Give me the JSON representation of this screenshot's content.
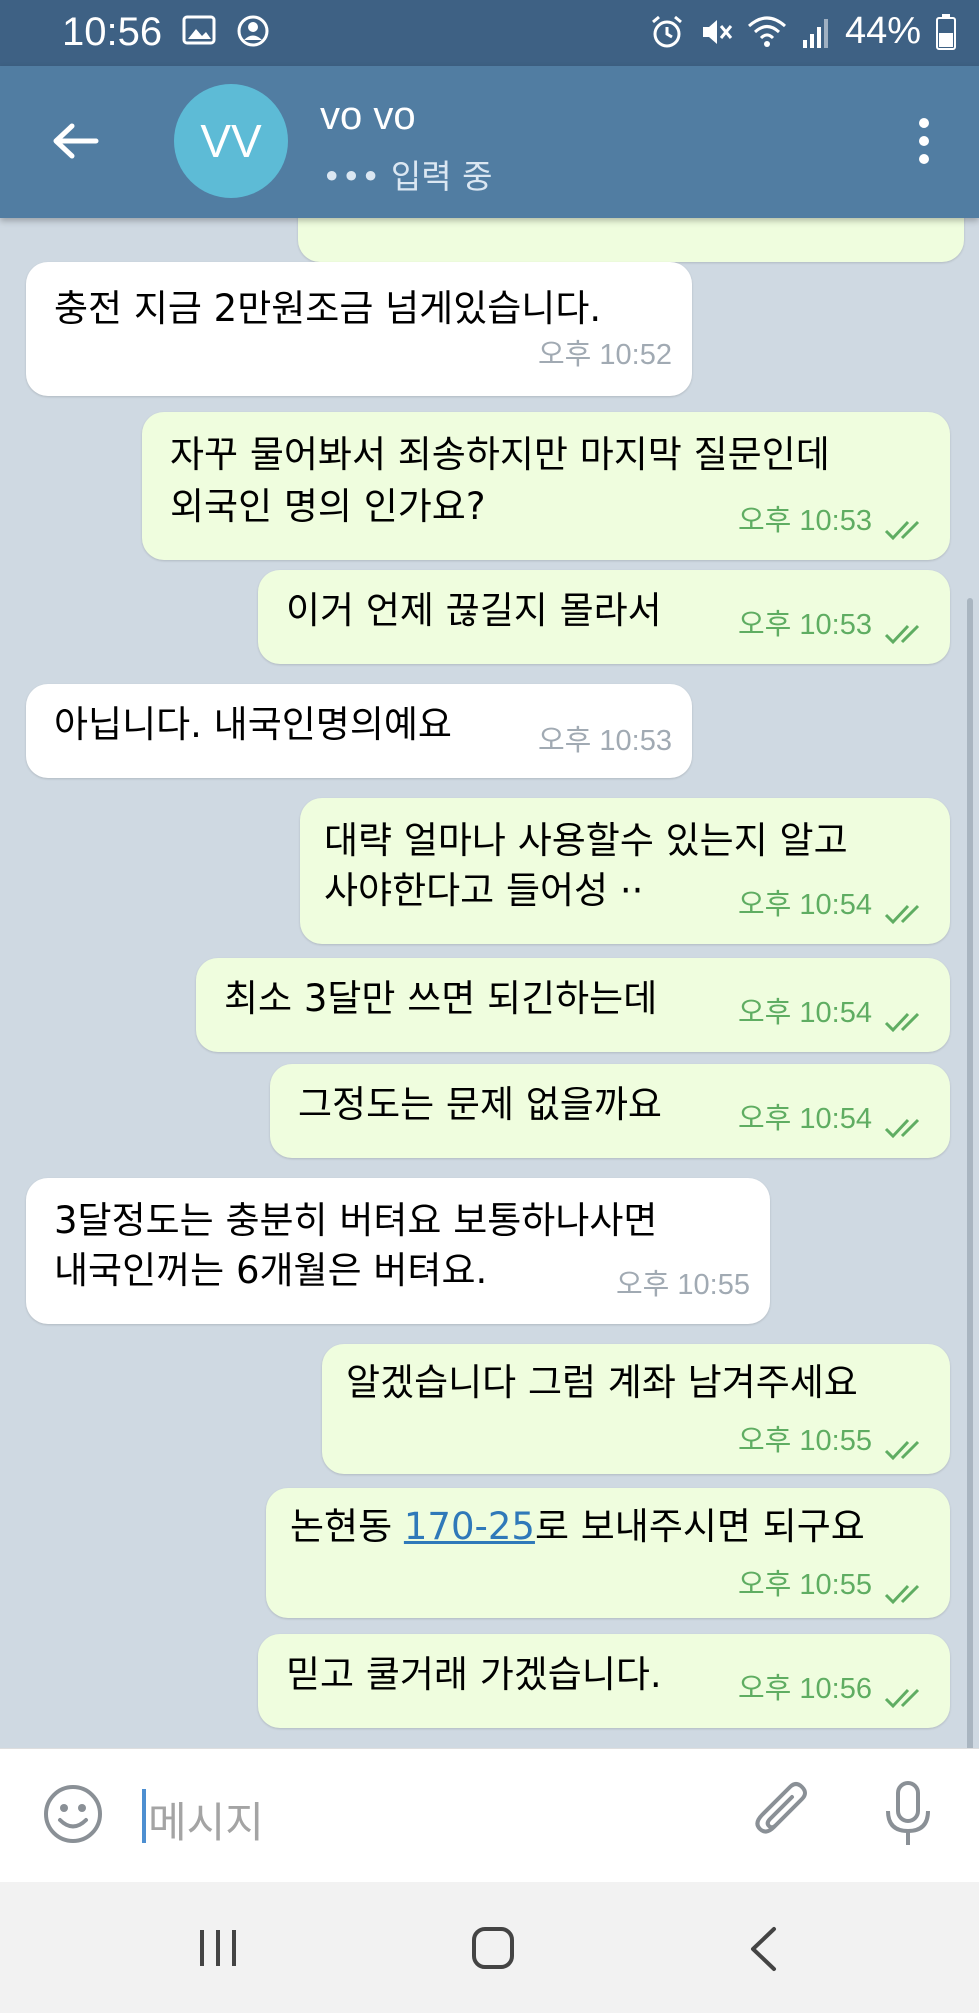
{
  "status_bar": {
    "time": "10:56",
    "battery": "44%"
  },
  "header": {
    "avatar_initials": "VV",
    "name": "vo vo",
    "status": "••• 입력 중"
  },
  "messages": [
    {
      "dir": "in",
      "text": "충전 지금 2만원조금 넘게있습니다.",
      "time": "오후 10:52"
    },
    {
      "dir": "out",
      "lines": [
        "자꾸 물어봐서 죄송하지만 마지막 질문인데",
        "외국인 명의 인가요?"
      ],
      "time": "오후 10:53"
    },
    {
      "dir": "out",
      "text": "이거 언제 끊길지 몰라서",
      "time": "오후 10:53"
    },
    {
      "dir": "in",
      "text": "아닙니다. 내국인명의예요",
      "time": "오후 10:53"
    },
    {
      "dir": "out",
      "lines": [
        "대략 얼마나 사용할수 있는지 알고",
        "사야한다고 들어성 ··"
      ],
      "time": "오후 10:54"
    },
    {
      "dir": "out",
      "text": "최소 3달만 쓰면 되긴하는데",
      "time": "오후 10:54"
    },
    {
      "dir": "out",
      "text": "그정도는 문제 없을까요",
      "time": "오후 10:54"
    },
    {
      "dir": "in",
      "lines": [
        "3달정도는 충분히 버텨요 보통하나사면",
        "내국인꺼는 6개월은 버텨요."
      ],
      "time": "오후 10:55"
    },
    {
      "dir": "out",
      "text": "알겠습니다 그럼 계좌 남겨주세요",
      "time": "오후 10:55"
    },
    {
      "dir": "out",
      "pre": "논현동 ",
      "link": "170-25",
      "post": "로 보내주시면 되구요",
      "time": "오후 10:55"
    },
    {
      "dir": "out",
      "text": "믿고 쿨거래 가겠습니다.",
      "time": "오후 10:56"
    }
  ],
  "input": {
    "placeholder": "메시지"
  },
  "icons": {
    "status": [
      "gallery-icon",
      "account-icon",
      "alarm-icon",
      "mute-icon",
      "wifi-icon",
      "signal-icon",
      "battery-icon"
    ],
    "header": [
      "back-arrow-icon",
      "more-vert-icon"
    ],
    "input": [
      "emoji-icon",
      "attach-icon",
      "mic-icon"
    ],
    "nav": [
      "recent-apps-icon",
      "home-icon",
      "nav-back-icon"
    ]
  },
  "colors": {
    "header": "#517da2",
    "status_bar": "#3e6184",
    "outgoing_bubble": "#effdde",
    "incoming_bubble": "#ffffff",
    "read_ticks": "#5fad62",
    "link": "#2f79b9"
  }
}
